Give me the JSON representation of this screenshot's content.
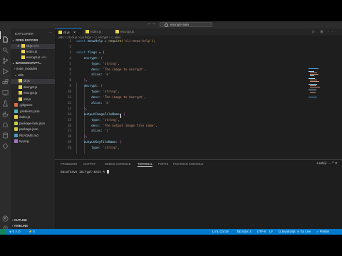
{
  "titlebar": {
    "nav": "← →",
    "search": "encrypt-main"
  },
  "activity": [
    "files-icon",
    "search-icon",
    "source-control-icon",
    "run-debug-icon",
    "extensions-icon",
    "remote-icon",
    "testing-icon",
    "docker-icon",
    "android-icon",
    "database-icon",
    "git-icon"
  ],
  "sidebar": {
    "title": "EXPLORER",
    "open_editors": "OPEN EDITORS",
    "open_files": [
      {
        "name": "cli.js",
        "hint": "utils",
        "icon": "js"
      },
      {
        "name": "index.js",
        "icon": "js"
      },
      {
        "name": "encrypt.js",
        "hint": "utils",
        "icon": "js"
      }
    ],
    "project": "IMAGEENCRYPT...",
    "tree": [
      {
        "name": "node_modules",
        "type": "folder",
        "depth": 1
      },
      {
        "name": "utils",
        "type": "folder",
        "depth": 1
      },
      {
        "name": "cli.js",
        "type": "js",
        "depth": 2,
        "selected": true
      },
      {
        "name": "decrypt.js",
        "type": "js",
        "depth": 2
      },
      {
        "name": "encrypt.js",
        "type": "js",
        "depth": 2
      },
      {
        "name": "init.js",
        "type": "js",
        "depth": 2
      },
      {
        "name": ".gitignore",
        "type": "git",
        "depth": 1
      },
      {
        "name": ".prettierrc.json",
        "type": "pretty",
        "depth": 1
      },
      {
        "name": "index.js",
        "type": "js",
        "depth": 1
      },
      {
        "name": "package-lock.json",
        "type": "json",
        "depth": 1
      },
      {
        "name": "package.json",
        "type": "json",
        "depth": 1
      },
      {
        "name": "README.md",
        "type": "md",
        "depth": 1
      },
      {
        "name": "try.png",
        "type": "png",
        "depth": 1
      }
    ],
    "outline": "OUTLINE",
    "timeline": "TIMELINE"
  },
  "tabs": [
    {
      "label": "cli.js",
      "active": true
    },
    {
      "label": "index.js",
      "active": false
    },
    {
      "label": "encrypt.js",
      "active": false
    }
  ],
  "breadcrumb": "utils > JS cli.js > [e] flags > ⬡ encrypt > ⬡ alias",
  "code": {
    "lines": [
      {
        "n": "1",
        "html": "<span class=\"k\">const</span> <span class=\"v\">meowHelp</span> <span class=\"p\">=</span> <span class=\"f\">require</span><span class=\"b\">(</span><span class=\"s\">'cli-meow-help'</span><span class=\"b\">)</span><span class=\"p\">;</span>"
      },
      {
        "n": "2",
        "html": ""
      },
      {
        "n": "3",
        "html": "<span class=\"k\">const</span> <span class=\"v\">flags</span> <span class=\"p\">=</span> <span class=\"b\">{</span>"
      },
      {
        "n": "4",
        "html": "    <span class=\"v\">encrypt</span><span class=\"p\">:</span> <span class=\"b2\">{</span>"
      },
      {
        "n": "5",
        "html": "        <span class=\"v\">type</span><span class=\"p\">:</span> <span class=\"s\">'string'</span><span class=\"p\">,</span>"
      },
      {
        "n": "6",
        "html": "        <span class=\"v\">desc</span><span class=\"p\">:</span> <span class=\"s\">'The image to encrypt'</span><span class=\"p\">,</span>"
      },
      {
        "n": "7",
        "html": "        <span class=\"v\">alias</span><span class=\"p\">:</span> <span class=\"s\">'e'</span>"
      },
      {
        "n": "8",
        "html": "    <span class=\"b2\">}</span><span class=\"p\">,</span>"
      },
      {
        "n": "9",
        "html": "    <span class=\"v\">decrypt</span><span class=\"p\">:</span> <span class=\"b2\">{</span>"
      },
      {
        "n": "10",
        "html": "        <span class=\"v\">type</span><span class=\"p\">:</span> <span class=\"s\">'string'</span><span class=\"p\">,</span>"
      },
      {
        "n": "11",
        "html": "        <span class=\"v\">desc</span><span class=\"p\">:</span> <span class=\"s\">'The image to decrypt'</span><span class=\"p\">,</span>"
      },
      {
        "n": "12",
        "html": "        <span class=\"v\">alias</span><span class=\"p\">:</span> <span class=\"s\">'d'</span>"
      },
      {
        "n": "13",
        "html": "    <span class=\"b2\">}</span><span class=\"p\">,</span>"
      },
      {
        "n": "14",
        "html": "    <span class=\"v\">outputImageFileName</span><span class=\"p\">:</span> <span class=\"b2\">{</span>"
      },
      {
        "n": "15",
        "html": "        <span class=\"v\">type</span><span class=\"p\">:</span> <span class=\"s\">'string'</span><span class=\"p\">,</span>"
      },
      {
        "n": "16",
        "html": "        <span class=\"v\">desc</span><span class=\"p\">:</span> <span class=\"s\">'The output image file name'</span><span class=\"p\">,</span>"
      },
      {
        "n": "17",
        "html": "        <span class=\"v\">alias</span><span class=\"p\">:</span> <span class=\"s\">'i'</span>"
      },
      {
        "n": "18",
        "html": "    <span class=\"b2\">}</span><span class=\"p\">,</span>"
      },
      {
        "n": "19",
        "html": "    <span class=\"v\">outputKeyFileName</span><span class=\"p\">:</span> <span class=\"b2\">{</span>"
      },
      {
        "n": "20",
        "html": "        <span class=\"v\">type</span><span class=\"p\">:</span> <span class=\"s\">'string'</span><span class=\"p\">,</span>"
      }
    ]
  },
  "panel": {
    "tabs": [
      "PROBLEMS",
      "OUTPUT",
      "DEBUG CONSOLE",
      "TERMINAL",
      "PORTS",
      "POSTMAN CONSOLE"
    ],
    "active": "TERMINAL",
    "shell": "zsh",
    "prompt": "macofuave imcrypt-main % "
  },
  "status": {
    "left": [
      "⊗ 0 ⚠ 0",
      "⚡ 0"
    ],
    "right": [
      "Ln 8, Col 19",
      "Tab Size: 4",
      "UTF-8",
      "LF",
      "{} JavaScript",
      "⊘ Go Live",
      "✓ Prettier"
    ]
  }
}
